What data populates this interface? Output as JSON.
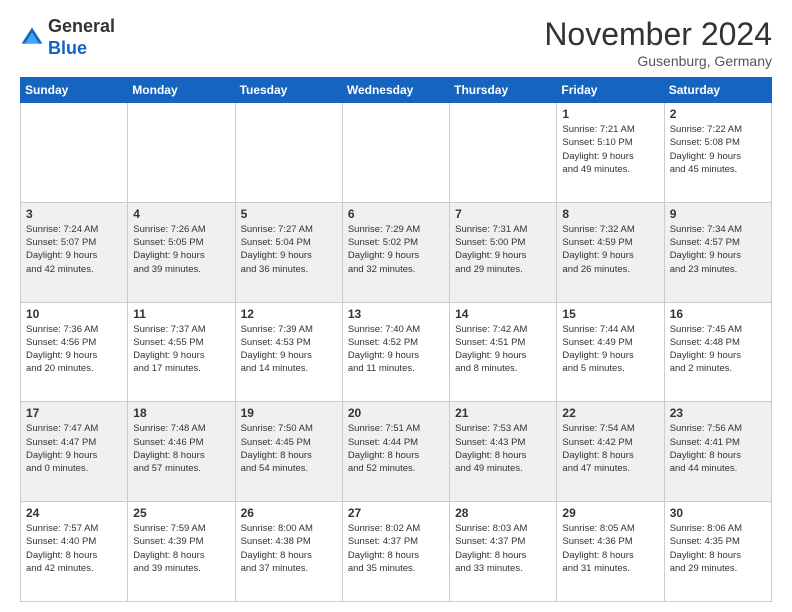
{
  "header": {
    "logo": {
      "general": "General",
      "blue": "Blue"
    },
    "title": "November 2024",
    "location": "Gusenburg, Germany"
  },
  "days_of_week": [
    "Sunday",
    "Monday",
    "Tuesday",
    "Wednesday",
    "Thursday",
    "Friday",
    "Saturday"
  ],
  "weeks": [
    [
      {
        "day": "",
        "info": ""
      },
      {
        "day": "",
        "info": ""
      },
      {
        "day": "",
        "info": ""
      },
      {
        "day": "",
        "info": ""
      },
      {
        "day": "",
        "info": ""
      },
      {
        "day": "1",
        "info": "Sunrise: 7:21 AM\nSunset: 5:10 PM\nDaylight: 9 hours\nand 49 minutes."
      },
      {
        "day": "2",
        "info": "Sunrise: 7:22 AM\nSunset: 5:08 PM\nDaylight: 9 hours\nand 45 minutes."
      }
    ],
    [
      {
        "day": "3",
        "info": "Sunrise: 7:24 AM\nSunset: 5:07 PM\nDaylight: 9 hours\nand 42 minutes."
      },
      {
        "day": "4",
        "info": "Sunrise: 7:26 AM\nSunset: 5:05 PM\nDaylight: 9 hours\nand 39 minutes."
      },
      {
        "day": "5",
        "info": "Sunrise: 7:27 AM\nSunset: 5:04 PM\nDaylight: 9 hours\nand 36 minutes."
      },
      {
        "day": "6",
        "info": "Sunrise: 7:29 AM\nSunset: 5:02 PM\nDaylight: 9 hours\nand 32 minutes."
      },
      {
        "day": "7",
        "info": "Sunrise: 7:31 AM\nSunset: 5:00 PM\nDaylight: 9 hours\nand 29 minutes."
      },
      {
        "day": "8",
        "info": "Sunrise: 7:32 AM\nSunset: 4:59 PM\nDaylight: 9 hours\nand 26 minutes."
      },
      {
        "day": "9",
        "info": "Sunrise: 7:34 AM\nSunset: 4:57 PM\nDaylight: 9 hours\nand 23 minutes."
      }
    ],
    [
      {
        "day": "10",
        "info": "Sunrise: 7:36 AM\nSunset: 4:56 PM\nDaylight: 9 hours\nand 20 minutes."
      },
      {
        "day": "11",
        "info": "Sunrise: 7:37 AM\nSunset: 4:55 PM\nDaylight: 9 hours\nand 17 minutes."
      },
      {
        "day": "12",
        "info": "Sunrise: 7:39 AM\nSunset: 4:53 PM\nDaylight: 9 hours\nand 14 minutes."
      },
      {
        "day": "13",
        "info": "Sunrise: 7:40 AM\nSunset: 4:52 PM\nDaylight: 9 hours\nand 11 minutes."
      },
      {
        "day": "14",
        "info": "Sunrise: 7:42 AM\nSunset: 4:51 PM\nDaylight: 9 hours\nand 8 minutes."
      },
      {
        "day": "15",
        "info": "Sunrise: 7:44 AM\nSunset: 4:49 PM\nDaylight: 9 hours\nand 5 minutes."
      },
      {
        "day": "16",
        "info": "Sunrise: 7:45 AM\nSunset: 4:48 PM\nDaylight: 9 hours\nand 2 minutes."
      }
    ],
    [
      {
        "day": "17",
        "info": "Sunrise: 7:47 AM\nSunset: 4:47 PM\nDaylight: 9 hours\nand 0 minutes."
      },
      {
        "day": "18",
        "info": "Sunrise: 7:48 AM\nSunset: 4:46 PM\nDaylight: 8 hours\nand 57 minutes."
      },
      {
        "day": "19",
        "info": "Sunrise: 7:50 AM\nSunset: 4:45 PM\nDaylight: 8 hours\nand 54 minutes."
      },
      {
        "day": "20",
        "info": "Sunrise: 7:51 AM\nSunset: 4:44 PM\nDaylight: 8 hours\nand 52 minutes."
      },
      {
        "day": "21",
        "info": "Sunrise: 7:53 AM\nSunset: 4:43 PM\nDaylight: 8 hours\nand 49 minutes."
      },
      {
        "day": "22",
        "info": "Sunrise: 7:54 AM\nSunset: 4:42 PM\nDaylight: 8 hours\nand 47 minutes."
      },
      {
        "day": "23",
        "info": "Sunrise: 7:56 AM\nSunset: 4:41 PM\nDaylight: 8 hours\nand 44 minutes."
      }
    ],
    [
      {
        "day": "24",
        "info": "Sunrise: 7:57 AM\nSunset: 4:40 PM\nDaylight: 8 hours\nand 42 minutes."
      },
      {
        "day": "25",
        "info": "Sunrise: 7:59 AM\nSunset: 4:39 PM\nDaylight: 8 hours\nand 39 minutes."
      },
      {
        "day": "26",
        "info": "Sunrise: 8:00 AM\nSunset: 4:38 PM\nDaylight: 8 hours\nand 37 minutes."
      },
      {
        "day": "27",
        "info": "Sunrise: 8:02 AM\nSunset: 4:37 PM\nDaylight: 8 hours\nand 35 minutes."
      },
      {
        "day": "28",
        "info": "Sunrise: 8:03 AM\nSunset: 4:37 PM\nDaylight: 8 hours\nand 33 minutes."
      },
      {
        "day": "29",
        "info": "Sunrise: 8:05 AM\nSunset: 4:36 PM\nDaylight: 8 hours\nand 31 minutes."
      },
      {
        "day": "30",
        "info": "Sunrise: 8:06 AM\nSunset: 4:35 PM\nDaylight: 8 hours\nand 29 minutes."
      }
    ]
  ]
}
